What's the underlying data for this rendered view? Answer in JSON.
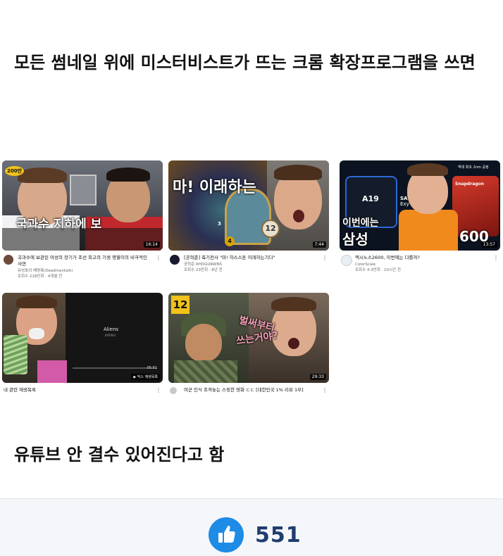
{
  "post": {
    "headline_1": "모든 썸네일 위에 미스터비스트가 뜨는 크롬 확장프로그램을 쓰면",
    "headline_2": "유튜브 안 결수 있어진다고 함"
  },
  "videos": [
    {
      "title": "국과수에 보관된 여성의 장기가 조선 최고의 기생 명월이의 비극적인 사연",
      "channel": "유성호의 해명록(Deadmantalk)",
      "stats": "조회수 218만회 · 4개월 전",
      "duration": "16:14",
      "overlay_text": "국과수 지하에 보",
      "badge": "200만"
    },
    {
      "title": "[공혁준] 축기전사 \"마! 하스스톤 이래하는기다\"",
      "channel": "공혁준 RHDGURWNS",
      "stats": "조회수 23만회 · 8년 전",
      "duration": "7:44",
      "overlay_text": "마! 이래하는",
      "num_badge": "12",
      "small_badge": "4",
      "small_num": "3"
    },
    {
      "title": "엑시노스2600, 이번에는 다를까?",
      "channel": "ColorScale",
      "stats": "조회수 4.3만회 · 10시간 전",
      "duration": "13:57",
      "overlay_text_1": "이번에는",
      "overlay_text_2": "삼성",
      "chip_label": "A19",
      "brand_label": "Snapdragon",
      "sa_label": "SA",
      "exy_label": "Exy",
      "num_label": "600",
      "corner_note": "역대 최초 2nm 공정"
    },
    {
      "title": "내 관련 재생목록",
      "duration": "05:51",
      "playlist_label": "믹스 재생목록",
      "mix_title": "Aliens",
      "mix_artist": "KIRIN3"
    },
    {
      "title": "여군 인식 조져놓는 스윗한 영화 ㄷㄷ [대한민국 1% 리뷰 1부]",
      "duration": "29:33",
      "age_badge": "12",
      "overlay_text_1": "벌써부터",
      "overlay_text_2": "쓰는거야?"
    }
  ],
  "footer": {
    "like_count": "551",
    "icon": "thumbs-up-icon"
  },
  "colors": {
    "like_blue": "#1e8be6",
    "count_navy": "#1f3d6e"
  }
}
